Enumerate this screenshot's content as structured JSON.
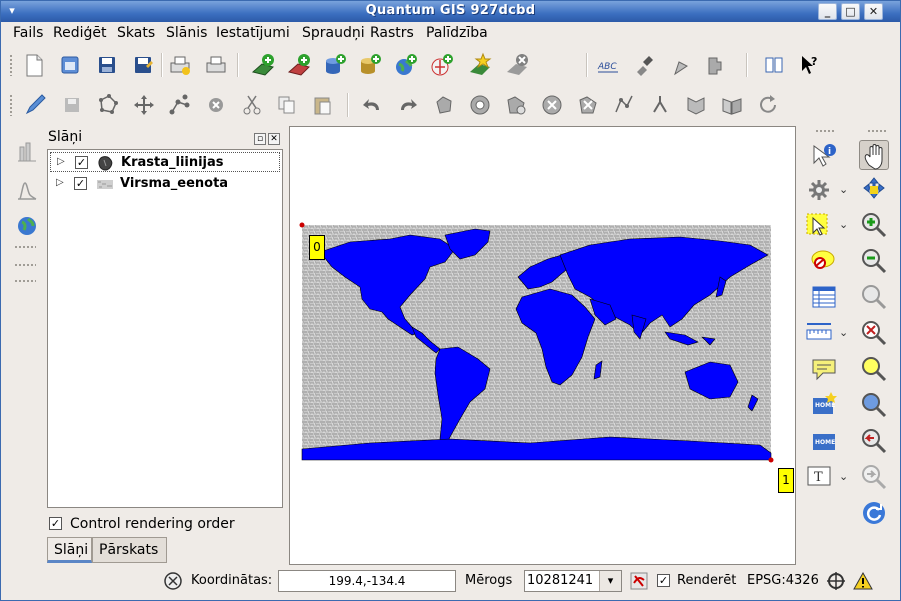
{
  "window": {
    "title": "Quantum GIS 927dcbd",
    "controls": {
      "minimize": "_",
      "maximize": "□",
      "close": "✕"
    }
  },
  "menu": {
    "items": [
      "Fails",
      "Rediģēt",
      "Skats",
      "Slānis",
      "Iestatījumi",
      "Spraudņi",
      "Rastrs",
      "Palīdzība"
    ]
  },
  "toolbar_main": {
    "icons": [
      "new-project-icon",
      "open-project-icon",
      "save-project-icon",
      "save-as-icon",
      "print-composer-icon",
      "print-icon",
      "add-vector-layer-icon",
      "add-raster-layer-icon",
      "add-postgis-layer-icon",
      "add-spatialite-layer-icon",
      "add-wms-layer-icon",
      "add-wfs-layer-icon",
      "new-vector-layer-icon",
      "remove-layer-icon",
      "label-icon",
      "pin-icon",
      "unpin-icon",
      "plugin-icon",
      "whats-this-icon"
    ]
  },
  "toolbar_edit": {
    "icons": [
      "toggle-editing-icon",
      "save-edits-icon",
      "capture-polygon-icon",
      "move-feature-icon",
      "node-tool-icon",
      "delete-selected-icon",
      "cut-icon",
      "copy-icon",
      "paste-icon",
      "undo-icon",
      "redo-icon",
      "simplify-icon",
      "add-ring-icon",
      "add-part-icon",
      "delete-ring-icon",
      "delete-part-icon",
      "reshape-icon",
      "split-icon",
      "merge-icon",
      "merge-attributes-icon",
      "rotate-icon"
    ]
  },
  "layers_panel": {
    "title": "Slāņi",
    "layers": [
      {
        "name": "Krasta_liinijas",
        "checked": true,
        "icon": "vector-polygon-icon"
      },
      {
        "name": "Virsma_eenota",
        "checked": true,
        "icon": "raster-icon"
      }
    ],
    "control_rendering_order": {
      "label": "Control rendering order",
      "checked": true
    },
    "tabs": [
      "Slāņi",
      "Pārskats"
    ]
  },
  "map": {
    "annotations": [
      {
        "text": "0"
      },
      {
        "text": "1"
      }
    ],
    "colors": {
      "land": "#0000ff",
      "relief": "#c8c8c8",
      "annotation_bg": "#ffff00"
    }
  },
  "right_tools": {
    "icons": [
      "identify-icon",
      "pan-icon",
      "settings-icon",
      "pan-to-selection-icon",
      "select-icon",
      "zoom-in-icon",
      "deselect-icon",
      "zoom-out-icon",
      "attribute-table-icon",
      "zoom-full-icon",
      "measure-icon",
      "zoom-to-selection-icon",
      "map-tips-icon",
      "zoom-to-layer-icon",
      "new-bookmark-icon",
      "zoom-actual-size-icon",
      "show-bookmarks-icon",
      "zoom-last-icon",
      "text-annotation-icon",
      "zoom-next-icon",
      "refresh-icon"
    ]
  },
  "status": {
    "coord_label": "Koordinātas:",
    "coord_value": "199.4,-134.4",
    "scale_label": "Mērogs",
    "scale_value": "10281241",
    "render_label": "Renderēt",
    "render_checked": true,
    "crs": "EPSG:4326"
  }
}
